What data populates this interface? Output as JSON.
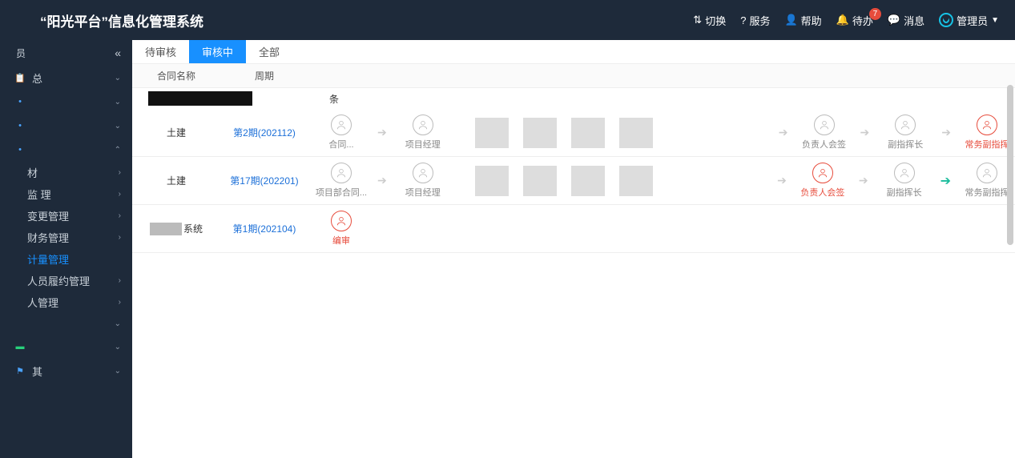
{
  "header": {
    "title": "“阳光平台”信息化管理系统",
    "items": {
      "switch": "切换",
      "service": "服务",
      "help": "帮助",
      "todo": "待办",
      "todo_badge": "7",
      "message": "消息",
      "admin": "管理员"
    }
  },
  "sidebar": {
    "top_label": "员",
    "group1_label": "总",
    "expanded_children": [
      {
        "label": "材",
        "key": "mat"
      },
      {
        "label": "监        理",
        "key": "mon"
      },
      {
        "label": "变更管理",
        "key": "change"
      },
      {
        "label": "财务管理",
        "key": "finance"
      },
      {
        "label": "计量管理",
        "key": "measure",
        "active": true
      },
      {
        "label": "人员履约管理",
        "key": "person"
      },
      {
        "label": "人管理",
        "key": "pm2"
      }
    ],
    "group_other1": "",
    "group_other2": "其"
  },
  "tabs": [
    {
      "label": "待审核",
      "key": "pending"
    },
    {
      "label": "审核中",
      "key": "reviewing",
      "active": true
    },
    {
      "label": "全部",
      "key": "all"
    }
  ],
  "table": {
    "headers": {
      "name": "合同名称",
      "period": "周期"
    },
    "meta_suffix": "条",
    "rows": [
      {
        "name": "土建",
        "period": "第2期(202112)",
        "flow_left": [
          {
            "label": "合同..."
          },
          {
            "type": "arrow"
          },
          {
            "label": "项目经理"
          }
        ],
        "flow_right": [
          {
            "type": "arrow"
          },
          {
            "label": "负责人会签"
          },
          {
            "type": "arrow"
          },
          {
            "label": "副指挥长"
          },
          {
            "type": "arrow"
          },
          {
            "label": "常务副指挥",
            "state": "red"
          }
        ]
      },
      {
        "name": "土建",
        "period": "第17期(202201)",
        "flow_left": [
          {
            "label": "项目部合同..."
          },
          {
            "type": "arrow"
          },
          {
            "label": "项目经理"
          }
        ],
        "flow_right": [
          {
            "type": "arrow"
          },
          {
            "label": "负责人会签",
            "state": "red"
          },
          {
            "type": "arrow"
          },
          {
            "label": "副指挥长"
          },
          {
            "type": "arrow-teal"
          },
          {
            "label": "常务副指挥"
          }
        ]
      },
      {
        "name": "系统",
        "period": "第1期(202104)",
        "flow_left": [
          {
            "label": "编审",
            "state": "red"
          }
        ],
        "flow_right": []
      }
    ]
  }
}
